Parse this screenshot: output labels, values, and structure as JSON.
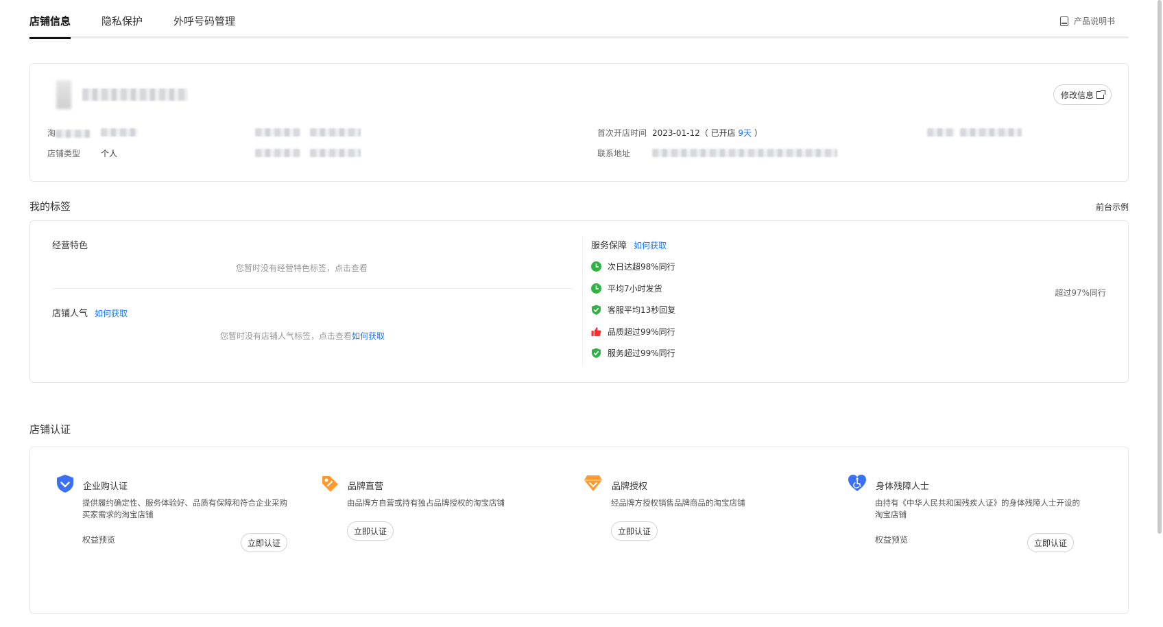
{
  "tabs": [
    {
      "label": "店铺信息",
      "active": true
    },
    {
      "label": "隐私保护",
      "active": false
    },
    {
      "label": "外呼号码管理",
      "active": false
    }
  ],
  "manual_link": "产品说明书",
  "store_info": {
    "edit_button": "修改信息",
    "label_tao_prefix": "淘",
    "label_open_time": "首次开店时间",
    "open_date": "2023-01-12",
    "open_status_prefix": "（ 已开店 ",
    "open_days": "9天",
    "open_status_suffix": " ）",
    "label_store_type": "店铺类型",
    "store_type": "个人",
    "label_address": "联系地址"
  },
  "tags_section": {
    "title": "我的标签",
    "example_link": "前台示例",
    "business": {
      "title": "经营特色",
      "empty_tip": "您暂时没有经营特色标签，点击查看"
    },
    "popularity": {
      "title": "店铺人气",
      "how_link": "如何获取",
      "empty_tip_prefix": "您暂时没有店铺人气标签，点击查看",
      "empty_tip_link": "如何获取"
    },
    "service": {
      "title": "服务保障",
      "how_link": "如何获取",
      "items": [
        {
          "text": "次日达超98%同行",
          "icon": "clock-icon",
          "color": "#2fb344"
        },
        {
          "text": "平均7小时发货",
          "icon": "clock-icon",
          "color": "#2fb344"
        },
        {
          "text": "客服平均13秒回复",
          "icon": "shield-check-icon",
          "color": "#2fb344"
        },
        {
          "text": "品质超过99%同行",
          "icon": "thumb-up-icon",
          "color": "#ff2d2d"
        },
        {
          "text": "服务超过99%同行",
          "icon": "shield-check-icon",
          "color": "#2fb344"
        }
      ],
      "extra": "超过97%同行"
    }
  },
  "cert_section": {
    "title": "店铺认证",
    "items": [
      {
        "title": "企业购认证",
        "desc": "提供履约确定性、服务体验好、品质有保障和符合企业采购买家需求的淘宝店铺",
        "preview": "权益预览",
        "button": "立即认证",
        "icon": "enterprise-shield-icon",
        "color": "#3b6ff5"
      },
      {
        "title": "品牌直营",
        "desc": "由品牌方自营或持有独占品牌授权的淘宝店铺",
        "preview": "",
        "button": "立即认证",
        "icon": "brand-tag-icon",
        "color": "#ff9a2e"
      },
      {
        "title": "品牌授权",
        "desc": "经品牌方授权销售品牌商品的淘宝店铺",
        "preview": "",
        "button": "立即认证",
        "icon": "brand-diamond-icon",
        "color": "#ff9a2e"
      },
      {
        "title": "身体残障人士",
        "desc": "由持有《中华人民共和国残疾人证》的身体残障人士开设的淘宝店铺",
        "preview": "权益预览",
        "button": "立即认证",
        "icon": "accessibility-heart-icon",
        "color": "#3b6ff5"
      }
    ]
  }
}
